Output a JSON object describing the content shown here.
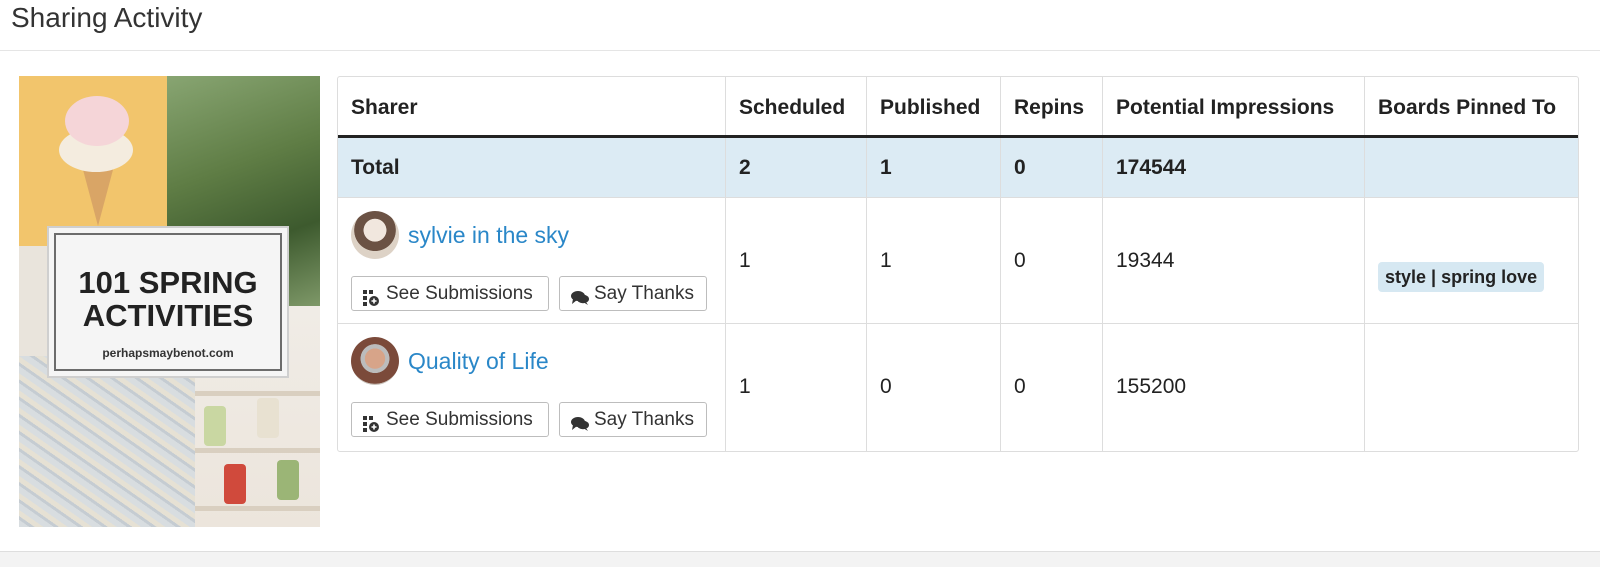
{
  "page": {
    "title": "Sharing Activity"
  },
  "pin": {
    "headline": "101 SPRING ACTIVITIES",
    "site": "perhapsmaybenot.com"
  },
  "table": {
    "headers": [
      "Sharer",
      "Scheduled",
      "Published",
      "Repins",
      "Potential Impressions",
      "Boards Pinned To"
    ],
    "total": {
      "label": "Total",
      "scheduled": "2",
      "published": "1",
      "repins": "0",
      "impressions": "174544",
      "boards": ""
    },
    "rows": [
      {
        "name": "sylvie in the sky",
        "scheduled": "1",
        "published": "1",
        "repins": "0",
        "impressions": "19344",
        "board": "style | spring love",
        "see_submissions": "See Submissions",
        "say_thanks": "Say Thanks"
      },
      {
        "name": "Quality of Life",
        "scheduled": "1",
        "published": "0",
        "repins": "0",
        "impressions": "155200",
        "board": "",
        "see_submissions": "See Submissions",
        "say_thanks": "Say Thanks"
      }
    ]
  },
  "icons": {
    "submissions": "submissions-grid-icon",
    "thanks": "chat-bubbles-icon"
  },
  "colors": {
    "link": "#2a87c8",
    "total_row_bg": "#dcebf4",
    "tag_bg": "#d6e8f2"
  }
}
